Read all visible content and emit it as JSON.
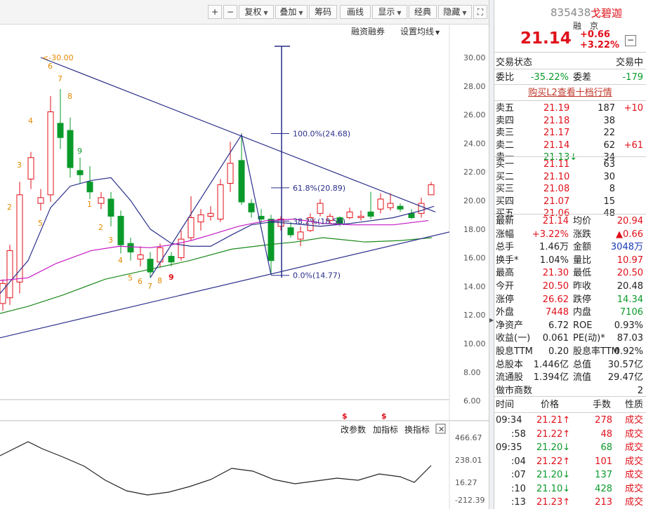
{
  "toolbar": {
    "plus": "+",
    "minus": "−",
    "fuquan": "复权",
    "diejia": "叠加",
    "chouma": "筹码",
    "huaxian": "画线",
    "xianshi": "显示",
    "jingdian": "经典",
    "yincang": "隐藏",
    "fullscreen": "⛶",
    "rongzi": "融资融券",
    "junxian": "设置均线"
  },
  "y_axis": [
    "30.00",
    "28.00",
    "26.00",
    "24.00",
    "22.00",
    "20.00",
    "18.00",
    "16.00",
    "14.00",
    "12.00",
    "10.00",
    "8.00",
    "6.00"
  ],
  "indicator_axis": [
    "466.67",
    "238.01",
    "16.27",
    "-212.39"
  ],
  "indicator_controls": {
    "params": "改参数",
    "add": "加指标",
    "switch": "换指标",
    "close": "✕"
  },
  "annotations": {
    "peak": "30.00",
    "fib_100": "100.0%(24.68)",
    "fib_618": "61.8%(20.89)",
    "fib_382": "38.2%(18.56)",
    "fib_0": "0.0%(14.77)",
    "dollar": "$"
  },
  "td_counts": [
    {
      "n": "2",
      "c": "#e38a00"
    },
    {
      "n": "3",
      "c": "#e38a00"
    },
    {
      "n": "4",
      "c": "#e38a00"
    },
    {
      "n": "5",
      "c": "#e38a00"
    },
    {
      "n": "6",
      "c": "#e38a00"
    },
    {
      "n": "7",
      "c": "#e38a00"
    },
    {
      "n": "8",
      "c": "#e38a00"
    },
    {
      "n": "9",
      "c": "#0a9a2a"
    },
    {
      "n": "1",
      "c": "#e38a00"
    },
    {
      "n": "2",
      "c": "#e38a00"
    },
    {
      "n": "3",
      "c": "#e38a00"
    },
    {
      "n": "4",
      "c": "#e38a00"
    },
    {
      "n": "5",
      "c": "#e38a00"
    },
    {
      "n": "6",
      "c": "#e38a00"
    },
    {
      "n": "7",
      "c": "#e38a00"
    },
    {
      "n": "8",
      "c": "#e38a00"
    },
    {
      "n": "9",
      "c": "#e0101a"
    }
  ],
  "stock": {
    "code": "835438",
    "name": "戈碧迦",
    "tag1": "融",
    "tag2": "京",
    "price": "21.14",
    "change": "+0.66",
    "pct": "+3.22%",
    "collapse": "−"
  },
  "status": {
    "label": "交易状态",
    "value": "交易中"
  },
  "weibi": {
    "l1": "委比",
    "v1": "-35.22%",
    "l2": "委差",
    "v2": "-179"
  },
  "l2_link": "购买L2查看十档行情",
  "asks": [
    {
      "label": "卖五",
      "price": "21.19",
      "vol": "187",
      "delta": "+10"
    },
    {
      "label": "卖四",
      "price": "21.18",
      "vol": "38",
      "delta": ""
    },
    {
      "label": "卖三",
      "price": "21.17",
      "vol": "22",
      "delta": ""
    },
    {
      "label": "卖二",
      "price": "21.14",
      "vol": "62",
      "delta": "+61"
    },
    {
      "label": "卖一",
      "price": "21.13",
      "vol": "34",
      "delta": ""
    }
  ],
  "bids": [
    {
      "label": "买一",
      "price": "21.11",
      "vol": "63"
    },
    {
      "label": "买二",
      "price": "21.10",
      "vol": "30"
    },
    {
      "label": "买三",
      "price": "21.08",
      "vol": "8"
    },
    {
      "label": "买四",
      "price": "21.07",
      "vol": "15"
    },
    {
      "label": "买五",
      "price": "21.06",
      "vol": "48"
    }
  ],
  "stats": [
    {
      "l1": "最新",
      "v1": "21.14",
      "c1": "red",
      "l2": "均价",
      "v2": "20.94",
      "c2": "red"
    },
    {
      "l1": "涨幅",
      "v1": "+3.22%",
      "c1": "red",
      "l2": "涨跌",
      "v2": "▲0.66",
      "c2": "red"
    },
    {
      "l1": "总手",
      "v1": "1.46万",
      "c1": "",
      "l2": "金额",
      "v2": "3048万",
      "c2": "blue"
    },
    {
      "l1": "换手*",
      "v1": "1.04%",
      "c1": "",
      "l2": "量比",
      "v2": "10.97",
      "c2": "red"
    },
    {
      "l1": "最高",
      "v1": "21.30",
      "c1": "red",
      "l2": "最低",
      "v2": "20.50",
      "c2": "red"
    },
    {
      "l1": "今开",
      "v1": "20.50",
      "c1": "red",
      "l2": "昨收",
      "v2": "20.48",
      "c2": ""
    },
    {
      "l1": "涨停",
      "v1": "26.62",
      "c1": "red",
      "l2": "跌停",
      "v2": "14.34",
      "c2": "green"
    },
    {
      "l1": "外盘",
      "v1": "7448",
      "c1": "red",
      "l2": "内盘",
      "v2": "7106",
      "c2": "green"
    },
    {
      "l1": "净资产",
      "v1": "6.72",
      "c1": "",
      "l2": "ROE",
      "v2": "0.93%",
      "c2": ""
    },
    {
      "l1": "收益(一)",
      "v1": "0.061",
      "c1": "",
      "l2": "PE(动)*",
      "v2": "87.03",
      "c2": ""
    },
    {
      "l1": "股息TTM",
      "v1": "0.20",
      "c1": "",
      "l2": "股息率TTM",
      "v2": "0.92%",
      "c2": ""
    },
    {
      "l1": "总股本",
      "v1": "1.446亿",
      "c1": "",
      "l2": "总值",
      "v2": "30.57亿",
      "c2": ""
    },
    {
      "l1": "流通股",
      "v1": "1.394亿",
      "c1": "",
      "l2": "流值",
      "v2": "29.47亿",
      "c2": ""
    },
    {
      "l1": "做市商数",
      "v1": "",
      "c1": "",
      "l2": "",
      "v2": "2",
      "c2": ""
    }
  ],
  "trades_header": {
    "time": "时间",
    "price": "价格",
    "vol": "手数",
    "nature": "性质"
  },
  "trades": [
    {
      "time": "09:34",
      "price": "21.21",
      "dir": "up",
      "vol": "278",
      "nature": "成交"
    },
    {
      "time": ":58",
      "price": "21.22",
      "dir": "up",
      "vol": "48",
      "nature": "成交"
    },
    {
      "time": "09:35",
      "price": "21.20",
      "dir": "down",
      "vol": "68",
      "nature": "成交"
    },
    {
      "time": ":04",
      "price": "21.22",
      "dir": "up",
      "vol": "101",
      "nature": "成交"
    },
    {
      "time": ":07",
      "price": "21.20",
      "dir": "down",
      "vol": "137",
      "nature": "成交"
    },
    {
      "time": ":10",
      "price": "21.10",
      "dir": "down",
      "vol": "428",
      "nature": "成交"
    },
    {
      "time": ":13",
      "price": "21.23",
      "dir": "up",
      "vol": "213",
      "nature": "成交"
    }
  ],
  "colors": {
    "up": "#e0101a",
    "down": "#0a9a2a",
    "blue": "#1a3ab8",
    "accent": "#e38a00",
    "line": "#2a2f8a"
  }
}
